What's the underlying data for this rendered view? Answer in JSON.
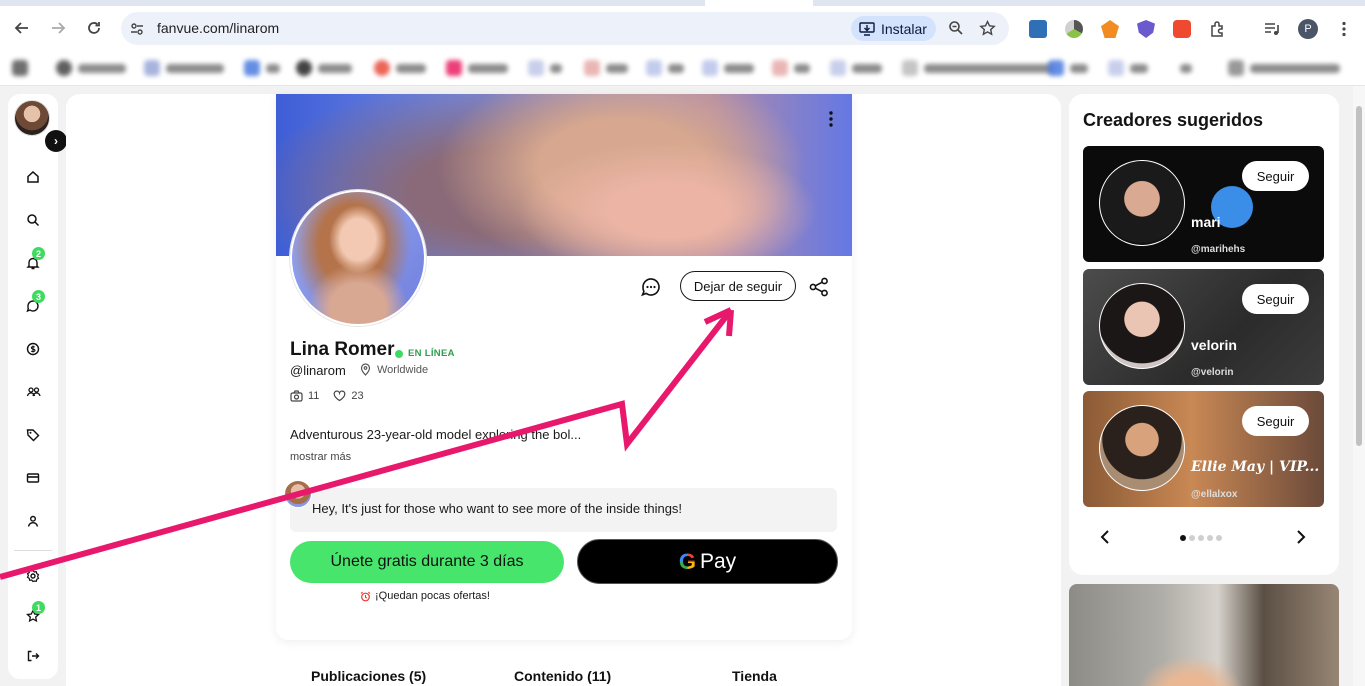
{
  "browser": {
    "url": "fanvue.com/linarom",
    "install_label": "Instalar",
    "profile_initial": "P"
  },
  "nav": {
    "badges": {
      "notifications": "2",
      "messages": "3",
      "favorites": "1"
    }
  },
  "profile": {
    "name": "Lina Romer",
    "online_label": "EN LÍNEA",
    "handle": "@linarom",
    "location": "Worldwide",
    "media_count": "11",
    "likes_count": "23",
    "bio": "Adventurous 23-year-old model exploring the bol...",
    "show_more": "mostrar más",
    "unfollow_label": "Dejar de seguir",
    "welcome_message": "Hey, It's just for those who want to see more of the inside things!",
    "join_label": "Únete gratis durante 3 días",
    "gpay_g": "G",
    "gpay_label": "Pay",
    "offers_label": "¡Quedan pocas ofertas!"
  },
  "tabs": [
    {
      "label": "Publicaciones (5)"
    },
    {
      "label": "Contenido (11)"
    },
    {
      "label": "Tienda"
    }
  ],
  "suggested": {
    "title": "Creadores sugeridos",
    "follow_label": "Seguir",
    "creators": [
      {
        "name": "mari",
        "handle": "@marihehs"
      },
      {
        "name": "velorin",
        "handle": "@velorin"
      },
      {
        "name": "Ellie May | VIP...",
        "handle": "@ellalxox"
      }
    ],
    "page_count": 5,
    "active_page": 1
  },
  "colors": {
    "accent_green": "#47e56c",
    "online_green": "#3ddc5e",
    "annotation_arrow": "#e8186c"
  }
}
